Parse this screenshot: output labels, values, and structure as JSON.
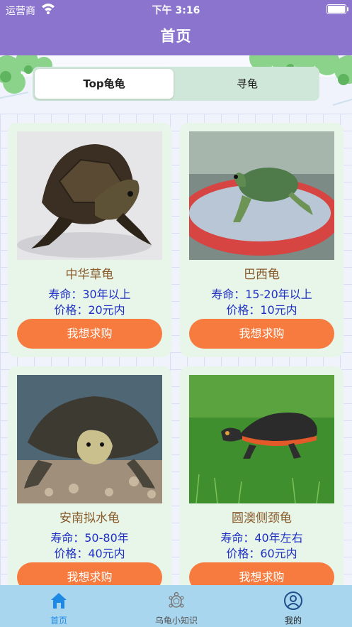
{
  "status_bar": {
    "carrier": "运营商",
    "time": "下午 3:16",
    "battery_level": 1.0
  },
  "nav": {
    "title": "首页"
  },
  "segments": {
    "active": "Top龟龟",
    "inactive": "寻龟"
  },
  "cards": [
    {
      "name": "中华草龟",
      "life": "寿命：30年以上",
      "price": "价格：20元内",
      "buy": "我想求购"
    },
    {
      "name": "巴西龟",
      "life": "寿命：15-20年以上",
      "price": "价格：10元内",
      "buy": "我想求购"
    },
    {
      "name": "安南拟水龟",
      "life": "寿命：50-80年",
      "price": "价格：40元内",
      "buy": "我想求购"
    },
    {
      "name": "圆澳侧颈龟",
      "life": "寿命：40年左右",
      "price": "价格：60元内",
      "buy": "我想求购"
    }
  ],
  "tabs": [
    {
      "label": "首页",
      "icon": "home-icon",
      "selected": true,
      "color": "#1e88e5"
    },
    {
      "label": "乌龟小知识",
      "icon": "turtle-icon",
      "selected": false,
      "color": "#555555"
    },
    {
      "label": "我的",
      "icon": "profile-icon",
      "selected": false,
      "color": "#222222"
    }
  ],
  "colors": {
    "header": "#8a74cd",
    "button": "#f77b3e",
    "card": "#e7f6e9",
    "tabbar": "#a9d6ef",
    "accent_text": "#1f2fc5",
    "name_text": "#8a5a2b"
  }
}
